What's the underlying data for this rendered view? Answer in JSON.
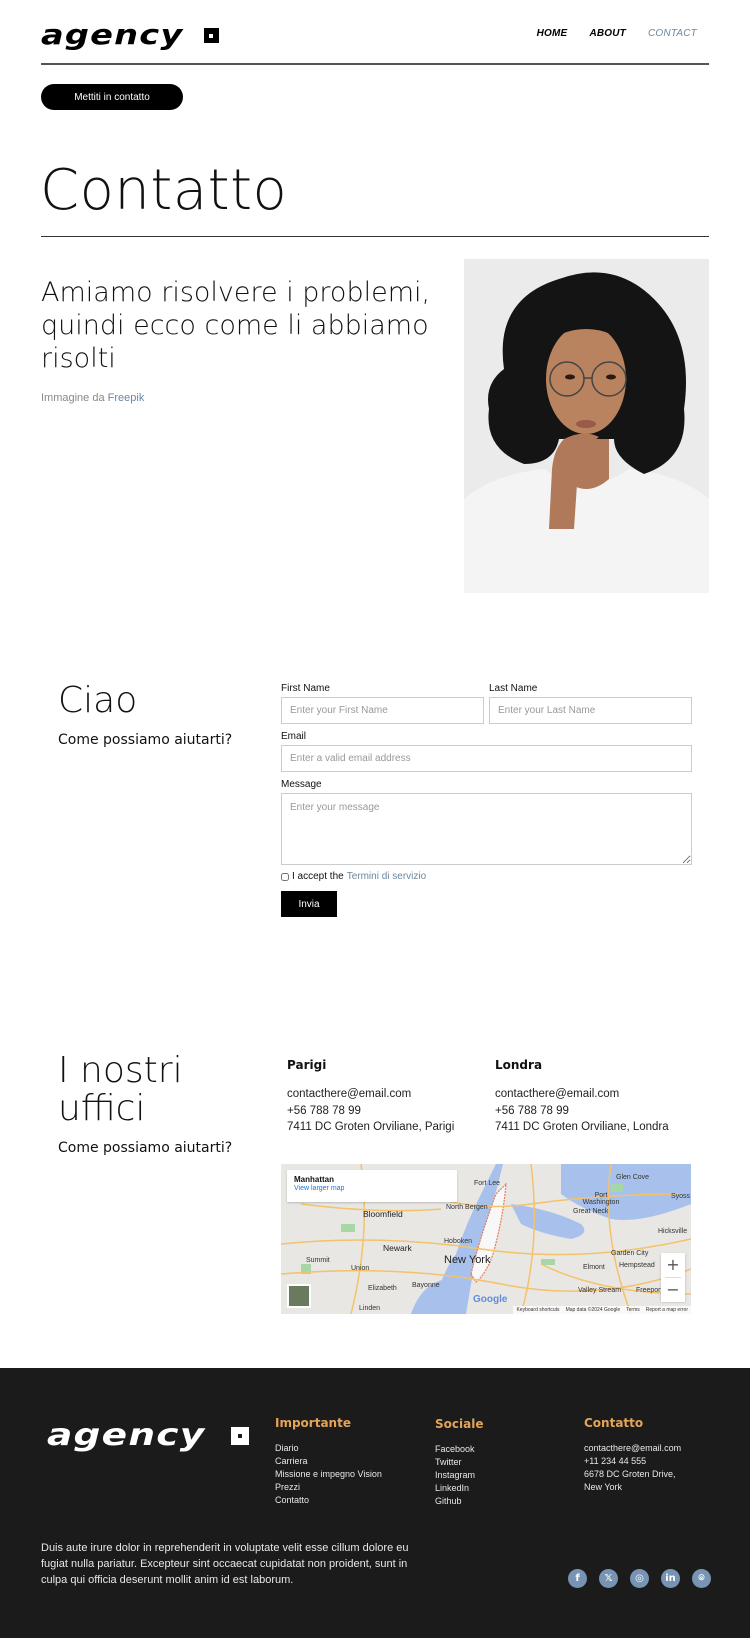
{
  "header": {
    "logo_text": "agency",
    "nav": [
      {
        "label": "HOME",
        "active": false
      },
      {
        "label": "ABOUT",
        "active": false
      },
      {
        "label": "CONTACT",
        "active": true
      }
    ],
    "cta_label": "Mettiti in contatto"
  },
  "hero": {
    "title": "Contatto",
    "headline": "Amiamo risolvere i problemi, quindi ecco come li abbiamo risolti",
    "credit_prefix": "Immagine da",
    "credit_link": "Freepik",
    "photo_alt": "Woman with glasses thinking"
  },
  "contact_form": {
    "title": "Ciao",
    "subtitle": "Come possiamo aiutarti?",
    "first_name": {
      "label": "First Name",
      "placeholder": "Enter your First Name",
      "value": ""
    },
    "last_name": {
      "label": "Last Name",
      "placeholder": "Enter your Last Name",
      "value": ""
    },
    "email": {
      "label": "Email",
      "placeholder": "Enter a valid email address",
      "value": ""
    },
    "message": {
      "label": "Message",
      "placeholder": "Enter your message",
      "value": ""
    },
    "accept_text": "I accept the",
    "terms_link": "Termini di servizio",
    "accept_checked": false,
    "submit_label": "Invia"
  },
  "offices": {
    "title": "I nostri uffici",
    "subtitle": "Come possiamo aiutarti?",
    "list": [
      {
        "city": "Parigi",
        "email": "contacthere@email.com",
        "phone": "+56 788 78 99",
        "address": "7411 DC Groten Orviliane, Parigi"
      },
      {
        "city": "Londra",
        "email": "contacthere@email.com",
        "phone": "+56 788 78 99",
        "address": "7411 DC Groten Orviliane, Londra"
      }
    ],
    "map": {
      "place": "Manhattan",
      "larger_map_link": "View larger map",
      "zoom_in": "+",
      "zoom_out": "−",
      "google": "Google",
      "attribution": [
        "Keyboard shortcuts",
        "Map data ©2024 Google",
        "Terms",
        "Report a map error"
      ],
      "labels": {
        "new_york": "New York",
        "newark": "Newark",
        "hoboken": "Hoboken",
        "north_bergen": "North Bergen",
        "fort_lee": "Fort Lee",
        "bloomfield": "Bloomfield",
        "glen_cove": "Glen Cove",
        "port_washington": "Port Washington",
        "great_neck": "Great Neck",
        "hicksville": "Hicksville",
        "garden_city": "Garden City",
        "hempstead": "Hempstead",
        "elmont": "Elmont",
        "valley_stream": "Valley Stream",
        "freeport": "Freeport",
        "summit": "Summit",
        "union": "Union",
        "elizabeth": "Elizabeth",
        "bayonne": "Bayonne",
        "linden": "Linden",
        "syosset": "Syoss"
      }
    }
  },
  "footer": {
    "logo_text": "agency",
    "columns": [
      {
        "title": "Importante",
        "items": [
          "Diario",
          "Carriera",
          "Missione e impegno Vision",
          "Prezzi",
          "Contatto"
        ]
      },
      {
        "title": "Sociale",
        "items": [
          "Facebook",
          "Twitter",
          "Instagram",
          "LinkedIn",
          "Github"
        ]
      },
      {
        "title": "Contatto",
        "items": [
          "contacthere@email.com",
          "+11 234 44 555",
          "6678 DC Groten Drive,",
          "New York"
        ]
      }
    ],
    "description": "Duis aute irure dolor in reprehenderit in voluptate velit esse cillum dolore eu fugiat nulla pariatur. Excepteur sint occaecat cupidatat non proident, sunt in culpa qui officia deserunt mollit anim id est laborum.",
    "socials": [
      {
        "name": "facebook",
        "glyph": "f"
      },
      {
        "name": "x",
        "glyph": "𝕏"
      },
      {
        "name": "instagram",
        "glyph": "◎"
      },
      {
        "name": "linkedin",
        "glyph": "in"
      },
      {
        "name": "github",
        "glyph": "⌾"
      }
    ],
    "accent_color": "#e3a458",
    "social_color": "#7894b4"
  }
}
